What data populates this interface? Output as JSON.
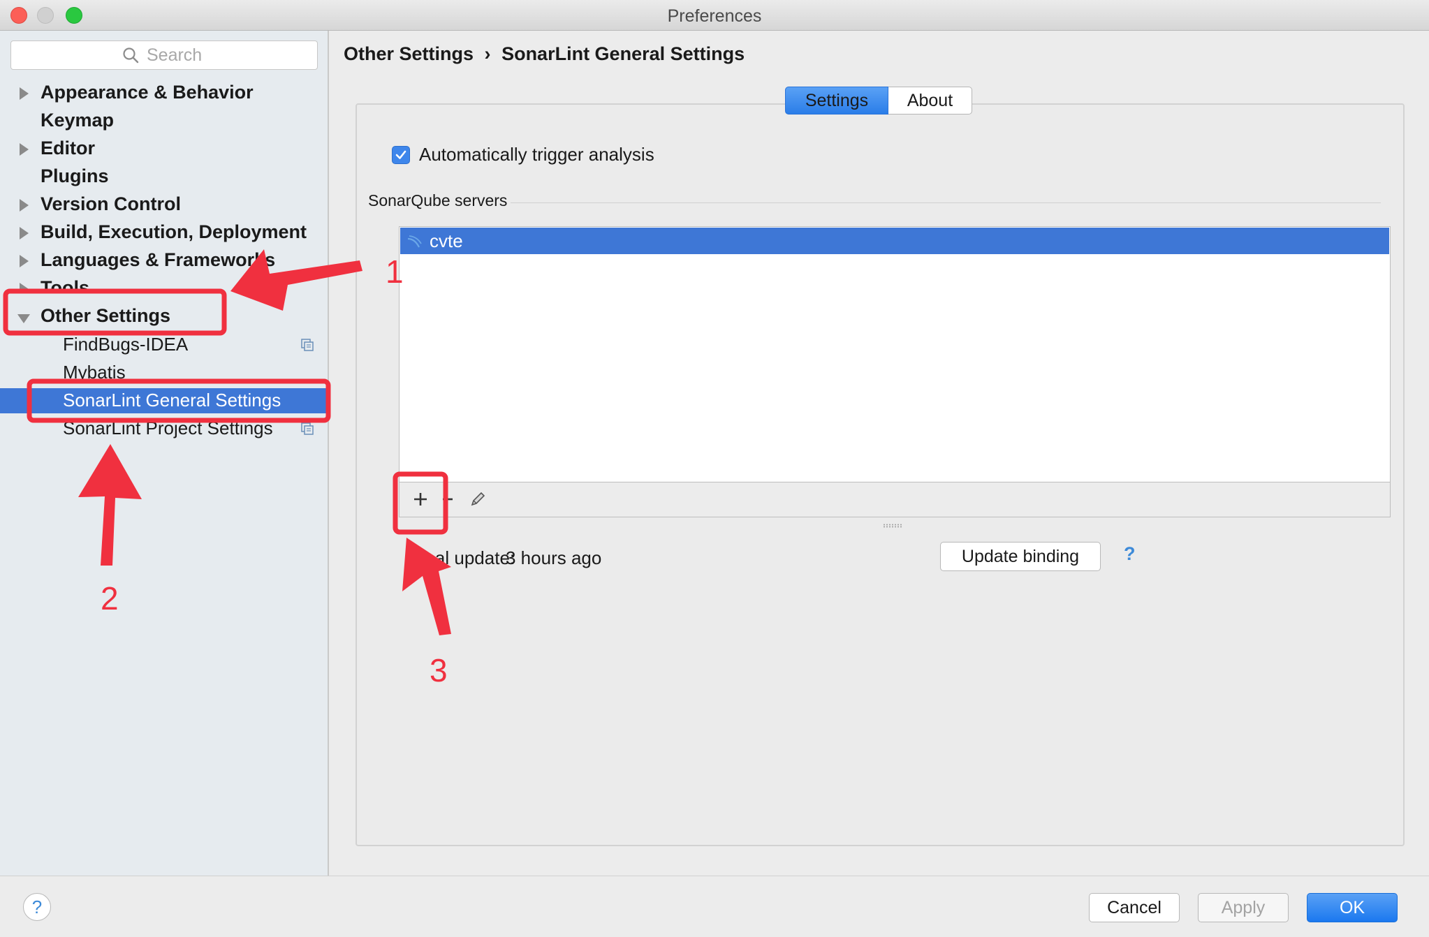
{
  "window": {
    "title": "Preferences"
  },
  "sidebar": {
    "search_placeholder": "Search",
    "items": [
      {
        "label": "Appearance & Behavior",
        "expandable": true
      },
      {
        "label": "Keymap",
        "expandable": false
      },
      {
        "label": "Editor",
        "expandable": true
      },
      {
        "label": "Plugins",
        "expandable": false
      },
      {
        "label": "Version Control",
        "expandable": true
      },
      {
        "label": "Build, Execution, Deployment",
        "expandable": true
      },
      {
        "label": "Languages & Frameworks",
        "expandable": true
      },
      {
        "label": "Tools",
        "expandable": true
      },
      {
        "label": "Other Settings",
        "expandable": true,
        "expanded": true
      }
    ],
    "children": [
      {
        "label": "FindBugs-IDEA",
        "project_icon": true
      },
      {
        "label": "Mybatis",
        "project_icon": false
      },
      {
        "label": "SonarLint General Settings",
        "selected": true
      },
      {
        "label": "SonarLint Project Settings",
        "project_icon": true
      }
    ]
  },
  "main": {
    "breadcrumb": [
      "Other Settings",
      "›",
      "SonarLint General Settings"
    ],
    "tabs": [
      {
        "label": "Settings",
        "active": true
      },
      {
        "label": "About",
        "active": false
      }
    ],
    "auto_trigger": {
      "label": "Automatically trigger analysis",
      "checked": true
    },
    "servers_group_title": "SonarQube servers",
    "servers": [
      {
        "name": "cvte",
        "selected": true
      }
    ],
    "toolbar": {
      "add": "+",
      "remove": "−",
      "edit": "edit-icon"
    },
    "local_update_label": "Local update:",
    "local_update_value": "3 hours ago",
    "update_binding_button": "Update binding",
    "help_link": "?"
  },
  "footer": {
    "help": "?",
    "cancel": "Cancel",
    "apply": "Apply",
    "ok": "OK"
  },
  "annotations": {
    "color": "#f0303f",
    "numbers": [
      "1",
      "2",
      "3"
    ]
  },
  "colors": {
    "selection": "#3e77d6",
    "accent_button": "#1b78ef"
  }
}
